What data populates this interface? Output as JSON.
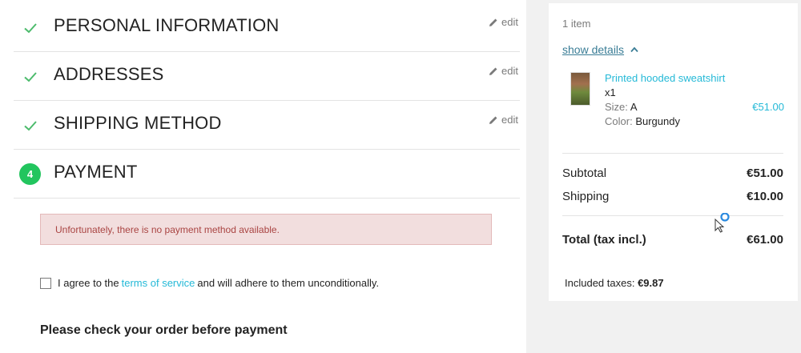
{
  "steps": [
    {
      "title": "PERSONAL INFORMATION",
      "edit": "edit"
    },
    {
      "title": "ADDRESSES",
      "edit": "edit"
    },
    {
      "title": "SHIPPING METHOD",
      "edit": "edit"
    },
    {
      "title": "PAYMENT",
      "number": "4"
    }
  ],
  "payment": {
    "alert": "Unfortunately, there is no payment method available.",
    "agree_prefix": "I agree to the",
    "agree_link": "terms of service",
    "agree_suffix": "and will adhere to them unconditionally.",
    "check_order": "Please check your order before payment"
  },
  "summary": {
    "items_count": "1 item",
    "show_details": "show details",
    "product": {
      "name": "Printed hooded sweatshirt",
      "qty": "x1",
      "size_label": "Size:",
      "size_value": "A",
      "color_label": "Color:",
      "color_value": "Burgundy",
      "price": "€51.00"
    },
    "subtotal_label": "Subtotal",
    "subtotal_value": "€51.00",
    "shipping_label": "Shipping",
    "shipping_value": "€10.00",
    "total_label": "Total (tax incl.)",
    "total_value": "€61.00",
    "taxes_label": "Included taxes:",
    "taxes_value": "€9.87"
  },
  "colors": {
    "accent": "#24b9d7",
    "step_badge": "#22c55e",
    "check": "#4cbb6c",
    "alert_bg": "#f2dede",
    "alert_text": "#a94442"
  },
  "icons": [
    "check-icon",
    "pencil-icon",
    "chevron-up-icon",
    "mouse-cursor-icon"
  ]
}
